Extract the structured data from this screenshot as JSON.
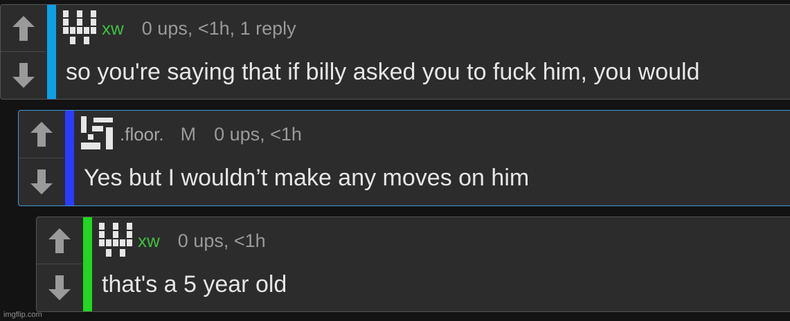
{
  "comments": [
    {
      "username": "xw",
      "username_color": "#3fbf3f",
      "mark": "",
      "stats": "0 ups, <1h, 1 reply",
      "text": "so you're saying that if billy asked you to fuck him, you would",
      "bar_color": "#0ea0e6",
      "avatar_icon": "pixel-w-avatar-icon"
    },
    {
      "username": ".floor.",
      "username_color": "#a6a6a6",
      "mark": "M",
      "stats": "0 ups, <1h",
      "text": "Yes but I wouldn’t make any moves on him",
      "bar_color": "#2b3bff",
      "avatar_icon": "pixel-swastika-like-avatar-icon"
    },
    {
      "username": "xw",
      "username_color": "#3fbf3f",
      "mark": "",
      "stats": "0 ups, <1h",
      "text": "that's a 5 year old",
      "bar_color": "#1fd81f",
      "avatar_icon": "pixel-w-avatar-icon"
    }
  ],
  "icons": {
    "upvote": "up-arrow-icon",
    "downvote": "down-arrow-icon"
  },
  "watermark": "imgflip.com"
}
